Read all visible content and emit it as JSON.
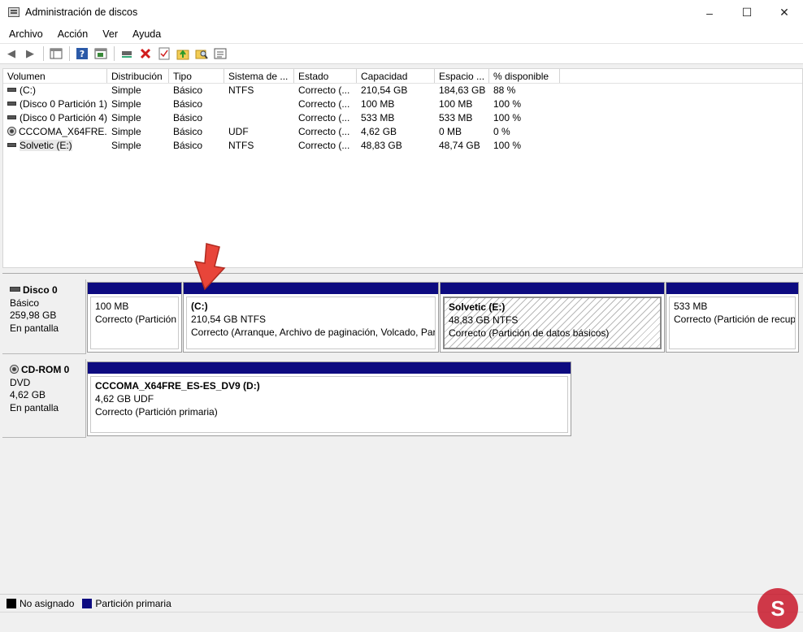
{
  "window": {
    "title": "Administración de discos"
  },
  "menu": [
    "Archivo",
    "Acción",
    "Ver",
    "Ayuda"
  ],
  "table": {
    "columns": [
      "Volumen",
      "Distribución",
      "Tipo",
      "Sistema de ...",
      "Estado",
      "Capacidad",
      "Espacio ...",
      "% disponible"
    ],
    "rows": [
      [
        "(C:)",
        "Simple",
        "Básico",
        "NTFS",
        "Correcto (...",
        "210,54 GB",
        "184,63 GB",
        "88 %"
      ],
      [
        "(Disco 0 Partición 1)",
        "Simple",
        "Básico",
        "",
        "Correcto (...",
        "100 MB",
        "100 MB",
        "100 %"
      ],
      [
        "(Disco 0 Partición 4)",
        "Simple",
        "Básico",
        "",
        "Correcto (...",
        "533 MB",
        "533 MB",
        "100 %"
      ],
      [
        "CCCOMA_X64FRE...",
        "Simple",
        "Básico",
        "UDF",
        "Correcto (...",
        "4,62 GB",
        "0 MB",
        "0 %"
      ],
      [
        "Solvetic (E:)",
        "Simple",
        "Básico",
        "NTFS",
        "Correcto (...",
        "48,83 GB",
        "48,74 GB",
        "100 %"
      ]
    ]
  },
  "disks": [
    {
      "name": "Disco 0",
      "type": "Básico",
      "size": "259,98 GB",
      "status": "En pantalla",
      "partitions": [
        {
          "title": "",
          "size": "100 MB",
          "desc": "Correcto (Partición"
        },
        {
          "title": "(C:)",
          "size": "210,54 GB NTFS",
          "desc": "Correcto (Arranque, Archivo de paginación, Volcado, Par"
        },
        {
          "title": "Solvetic  (E:)",
          "size": "48,83 GB NTFS",
          "desc": "Correcto (Partición de datos básicos)"
        },
        {
          "title": "",
          "size": "533 MB",
          "desc": "Correcto (Partición de recup"
        }
      ]
    },
    {
      "name": "CD-ROM 0",
      "type": "DVD",
      "size": "4,62 GB",
      "status": "En pantalla",
      "partitions": [
        {
          "title": "CCCOMA_X64FRE_ES-ES_DV9  (D:)",
          "size": "4,62 GB UDF",
          "desc": "Correcto (Partición primaria)"
        }
      ]
    }
  ],
  "legend": [
    {
      "label": "No asignado",
      "color": "#000000"
    },
    {
      "label": "Partición primaria",
      "color": "#0d0b80"
    }
  ],
  "watermark": {
    "text": "S"
  }
}
